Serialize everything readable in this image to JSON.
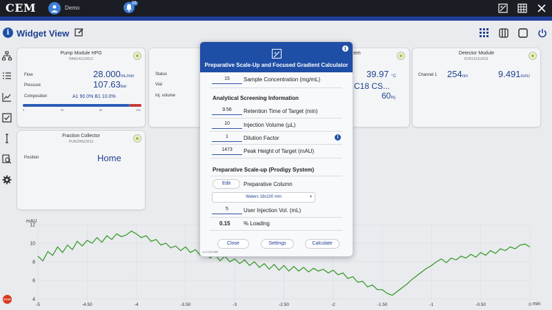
{
  "topbar": {
    "logo": "CEM",
    "user_name": "Demo",
    "notification_count": "29"
  },
  "header": {
    "title": "Widget View"
  },
  "pump": {
    "title": "Pump Module HPG",
    "serial": "PAM141110012",
    "flow_label": "Flow",
    "flow_value": "28.000",
    "flow_unit": "mL/min",
    "pressure_label": "Pressure",
    "pressure_value": "107.63",
    "pressure_unit": "bar",
    "composition_label": "Composition",
    "composition_value": "A1 90.0% B1 10.0%",
    "ticks": [
      "0",
      "30",
      "60",
      "100"
    ],
    "progress": 0.9
  },
  "autosampler": {
    "status_label": "Status",
    "vial_label": "Vial",
    "inj_label": "Inj. volume"
  },
  "column": {
    "title_fragment": "tem",
    "temp_value": "39.97",
    "temp_unit": "°C",
    "name_value": "C18 CS...",
    "inj_value": "60",
    "inj_unit": "Inj."
  },
  "detector": {
    "title": "Detector Module",
    "serial": "FDD141210011",
    "channel_label": "Channel 1",
    "wavelength_value": "254",
    "wavelength_unit": "nm",
    "absorbance_value": "9.491",
    "absorbance_unit": "mAU"
  },
  "fraction": {
    "title": "Fraction Collector",
    "serial": "PUA234510013",
    "position_label": "Position",
    "position_value": "Home"
  },
  "modal": {
    "title": "Preparative Scale-Up and Focused Gradient Calculator",
    "sample_conc_value": "15",
    "sample_conc_label": "Sample Concentration (mg/mL)",
    "analytical_title": "Analytical Screening Information",
    "retention_value": "9.56",
    "retention_label": "Retention Time of Target (min)",
    "injection_value": "10",
    "injection_label": "Injection Volume (µL)",
    "dilution_value": "1",
    "dilution_label": "Dilution Factor",
    "peak_value": "1473",
    "peak_label": "Peak Height of Target (mAU)",
    "prep_title": "Preparative Scale-up (Prodigy System)",
    "edit_label": "Edit",
    "prep_column_label": "Preparative Column",
    "column_selected": "Waters 19x100 mm",
    "user_inj_value": "5",
    "user_inj_label": "User Injection Vol. (mL)",
    "loading_value": "0.15",
    "loading_label": "% Loading",
    "close_label": "Close",
    "settings_label": "Settings",
    "calculate_label": "Calculate",
    "version": "v1.0.223.895"
  },
  "chart_data": {
    "type": "line",
    "ylabel": "mAU",
    "xlabel": "min",
    "xlim": [
      -5,
      0
    ],
    "ylim": [
      4,
      12
    ],
    "x_ticks": [
      "-5",
      "-4.50",
      "-4",
      "-3.50",
      "-3",
      "-2.50",
      "-2",
      "-1.50",
      "-1",
      "-0.50",
      "0"
    ],
    "y_ticks": [
      "4",
      "6",
      "8",
      "10",
      "12"
    ],
    "series": [
      {
        "color": "#3a9a2a",
        "x": [
          -5,
          -4.95,
          -4.9,
          -4.85,
          -4.8,
          -4.75,
          -4.7,
          -4.65,
          -4.6,
          -4.55,
          -4.5,
          -4.45,
          -4.4,
          -4.35,
          -4.3,
          -4.25,
          -4.2,
          -4.15,
          -4.1,
          -4.05,
          -4,
          -3.95,
          -3.9,
          -3.85,
          -3.8,
          -3.75,
          -3.7,
          -3.65,
          -3.6,
          -3.55,
          -3.5,
          -3.45,
          -3.4,
          -3.35,
          -3.3,
          -3.25,
          -3.2,
          -3.15,
          -3.1,
          -3.05,
          -3,
          -2.95,
          -2.9,
          -2.85,
          -2.8,
          -2.75,
          -2.7,
          -2.65,
          -2.6,
          -2.55,
          -2.5,
          -2.45,
          -2.4,
          -2.35,
          -2.3,
          -2.25,
          -2.2,
          -2.15,
          -2.1,
          -2.05,
          -2,
          -1.95,
          -1.9,
          -1.85,
          -1.8,
          -1.75,
          -1.7,
          -1.65,
          -1.6,
          -1.55,
          -1.5,
          -1.45,
          -1.4,
          -1.35,
          -1.3,
          -1.25,
          -1.2,
          -1.15,
          -1.1,
          -1.05,
          -1,
          -0.95,
          -0.9,
          -0.85,
          -0.8,
          -0.75,
          -0.7,
          -0.65,
          -0.6,
          -0.55,
          -0.5,
          -0.45,
          -0.4,
          -0.35,
          -0.3,
          -0.25,
          -0.2,
          -0.15,
          -0.1,
          -0.05,
          0
        ],
        "y": [
          8.6,
          8.1,
          9.1,
          8.7,
          9.6,
          9.0,
          9.8,
          9.3,
          10.2,
          9.7,
          10.3,
          10.0,
          10.6,
          10.1,
          10.8,
          10.4,
          11.0,
          10.7,
          10.9,
          11.3,
          11.0,
          10.6,
          10.8,
          10.2,
          10.4,
          9.8,
          10.0,
          9.5,
          9.7,
          9.2,
          9.6,
          9.0,
          9.3,
          8.7,
          9.0,
          8.4,
          8.8,
          8.1,
          8.6,
          8.0,
          8.3,
          7.8,
          8.2,
          7.6,
          8.0,
          7.4,
          7.8,
          7.2,
          7.7,
          7.1,
          7.6,
          7.0,
          7.5,
          7.0,
          7.4,
          6.9,
          7.3,
          7.0,
          7.2,
          6.8,
          7.1,
          6.6,
          6.8,
          6.2,
          6.4,
          5.8,
          5.9,
          5.3,
          5.5,
          5.0,
          5.0,
          4.6,
          4.4,
          4.8,
          5.2,
          5.6,
          6.1,
          6.5,
          6.9,
          7.3,
          7.6,
          8.0,
          8.3,
          7.9,
          8.4,
          8.2,
          8.6,
          8.4,
          8.8,
          8.5,
          9.0,
          8.7,
          9.2,
          8.9,
          9.4,
          9.2,
          9.6,
          9.4,
          9.8,
          9.9,
          9.6
        ]
      }
    ]
  }
}
